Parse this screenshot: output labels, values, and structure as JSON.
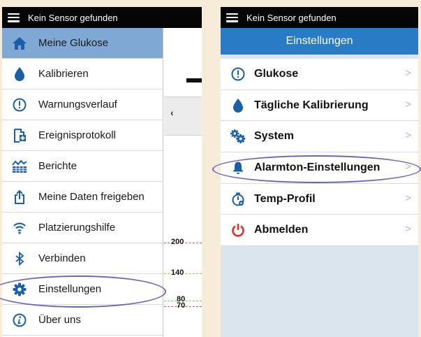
{
  "left": {
    "status_title": "Kein Sensor gefunden",
    "menu": [
      {
        "label": "Meine Glukose",
        "icon": "home-icon",
        "active": true
      },
      {
        "label": "Kalibrieren",
        "icon": "drop-icon"
      },
      {
        "label": "Warnungsverlauf",
        "icon": "alert-circle-icon"
      },
      {
        "label": "Ereignisprotokoll",
        "icon": "add-event-icon"
      },
      {
        "label": "Berichte",
        "icon": "report-icon"
      },
      {
        "label": "Meine Daten freigeben",
        "icon": "share-icon"
      },
      {
        "label": "Platzierungshilfe",
        "icon": "signal-icon"
      },
      {
        "label": "Verbinden",
        "icon": "bluetooth-icon"
      },
      {
        "label": "Einstellungen",
        "icon": "gear-icon"
      },
      {
        "label": "Über uns",
        "icon": "info-icon"
      }
    ],
    "graph_labels": {
      "high": "200",
      "target": "140",
      "low_a": "80",
      "low_b": "70"
    }
  },
  "right": {
    "status_title": "Kein Sensor gefunden",
    "title": "Einstellungen",
    "items": [
      {
        "label": "Glukose",
        "icon": "alert-circle-icon"
      },
      {
        "label": "Tägliche Kalibrierung",
        "icon": "drop-icon"
      },
      {
        "label": "System",
        "icon": "gears-icon"
      },
      {
        "label": "Alarmton-Einstellungen",
        "icon": "bell-icon"
      },
      {
        "label": "Temp-Profil",
        "icon": "temp-profile-icon"
      },
      {
        "label": "Abmelden",
        "icon": "power-icon"
      }
    ],
    "chevron": ">"
  },
  "colors": {
    "active_bg": "#7fa8d4",
    "title_bar": "#2a7bc6",
    "icon_blue": "#1b5fa7",
    "power_red": "#d7322a",
    "highlight_ring": "#6a67b8"
  }
}
